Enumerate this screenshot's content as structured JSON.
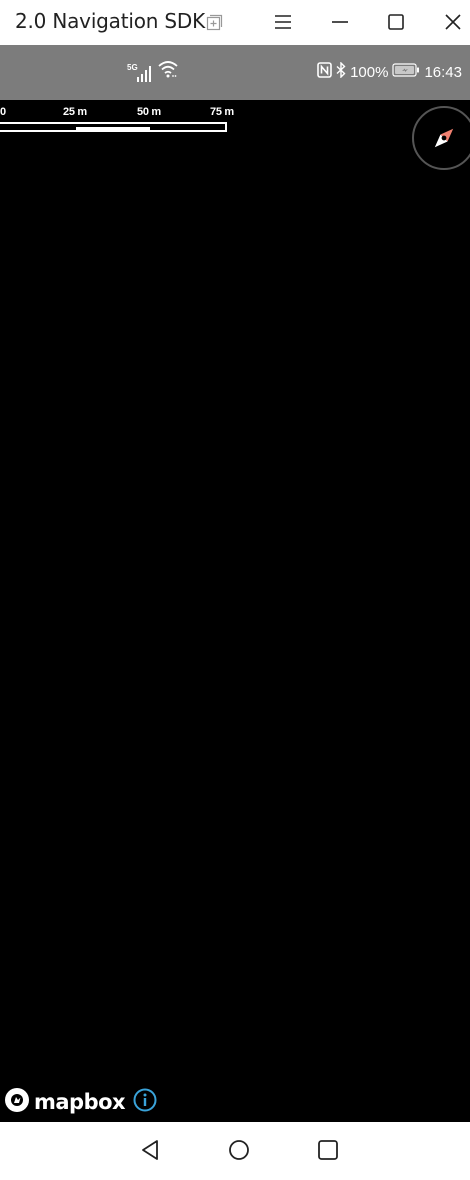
{
  "window": {
    "title": "2.0 Navigation SDK"
  },
  "status_bar": {
    "network_type": "5G",
    "battery_percent": "100%",
    "time": "16:43"
  },
  "map": {
    "scale": {
      "labels": [
        "0",
        "25 m",
        "50 m",
        "75 m"
      ]
    },
    "attribution": {
      "logo_text": "mapbox"
    }
  },
  "colors": {
    "titlebar_bg": "#ffffff",
    "statusbar_bg": "#7c7c7c",
    "map_bg": "#000000",
    "compass_needle": "#f08070",
    "info_icon": "#3aa3d9"
  },
  "icons": {
    "window_extra": "new-window-icon",
    "menu": "hamburger-icon",
    "minimize": "minimize-icon",
    "maximize": "maximize-icon",
    "close": "close-icon",
    "compass": "compass-icon",
    "attribution_info": "info-icon",
    "nav_back": "back-triangle-icon",
    "nav_home": "home-circle-icon",
    "nav_recents": "recents-square-icon"
  }
}
